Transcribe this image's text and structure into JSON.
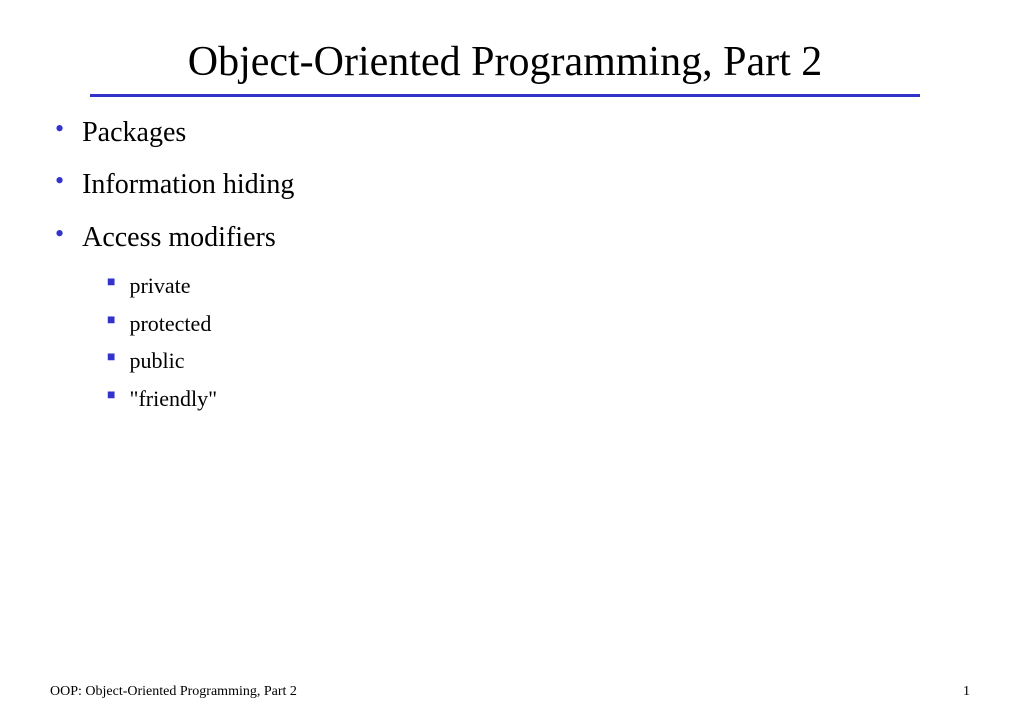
{
  "slide": {
    "title": "Object-Oriented Programming, Part 2",
    "bullets": {
      "b0": "Packages",
      "b1": "Information hiding",
      "b2": "Access modifiers"
    },
    "sub": {
      "s0": "private",
      "s1": "protected",
      "s2": "public",
      "s3": "\"friendly\""
    }
  },
  "footer": {
    "left": "OOP: Object-Oriented Programming, Part 2",
    "page": "1"
  }
}
